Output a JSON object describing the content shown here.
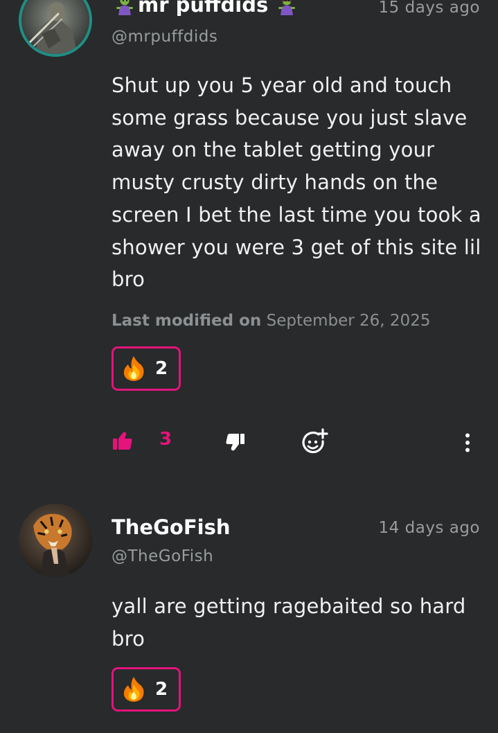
{
  "comments": [
    {
      "name": "mr puffdids",
      "name_emoji": "zombie",
      "handle": "@mrpuffdids",
      "time": "15 days ago",
      "body": "Shut up you 5 year old and touch some grass because you just slave away on the tablet getting your musty crusty dirty hands on the screen I bet the last time you took a shower you were 3 get of this site lil bro",
      "modified_label": "Last modified on",
      "modified_date": "September 26, 2025",
      "reaction": {
        "icon": "fire",
        "count": "2"
      },
      "likes": "3",
      "avatar_icon": "warrior-avatar"
    },
    {
      "name": "TheGoFish",
      "handle": "@TheGoFish",
      "time": "14 days ago",
      "body": "yall are getting ragebaited so hard bro",
      "reaction": {
        "icon": "fire",
        "count": "2"
      },
      "avatar_icon": "tiger-avatar"
    }
  ],
  "colors": {
    "background": "#282a2b",
    "accent": "#e5137c",
    "muted": "#9a9d9f",
    "avatar_ring": "#1f8f86"
  }
}
